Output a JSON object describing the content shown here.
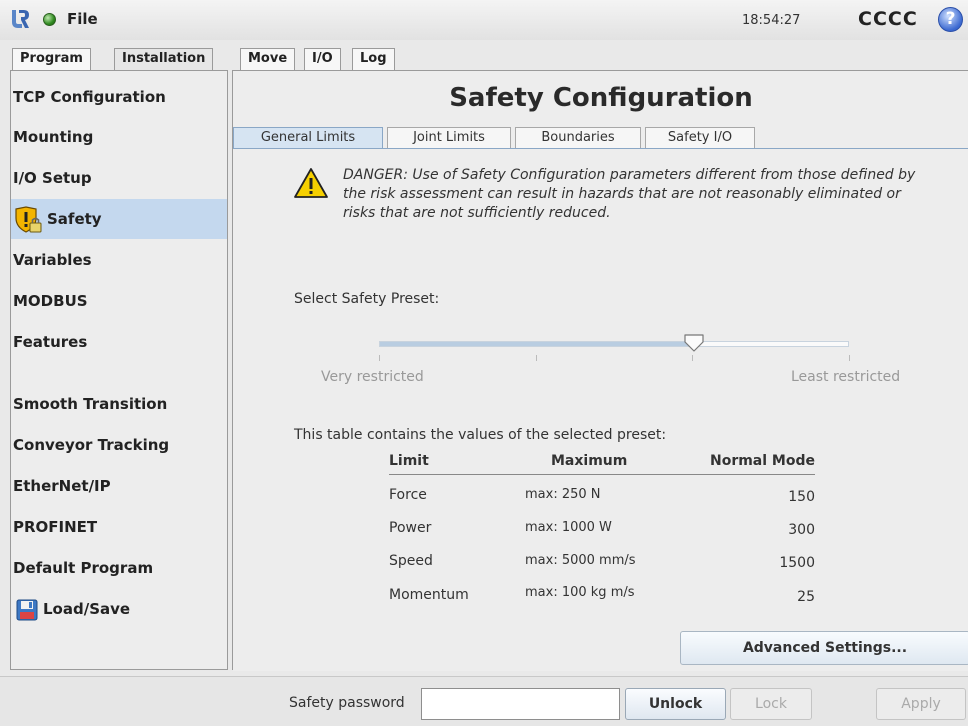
{
  "header": {
    "file_label": "File",
    "clock": "18:54:27",
    "robot_name": "CCCC",
    "help_glyph": "?"
  },
  "main_tabs": [
    {
      "label": "Program",
      "active": false
    },
    {
      "label": "Installation",
      "active": true
    },
    {
      "label": "Move",
      "active": false
    },
    {
      "label": "I/O",
      "active": false
    },
    {
      "label": "Log",
      "active": false
    }
  ],
  "sidebar": {
    "items": [
      {
        "label": "TCP Configuration"
      },
      {
        "label": "Mounting"
      },
      {
        "label": "I/O Setup"
      },
      {
        "label": "Safety",
        "icon": "shield-lock-icon",
        "active": true
      },
      {
        "label": "Variables"
      },
      {
        "label": "MODBUS"
      },
      {
        "label": "Features"
      },
      {
        "label": "Smooth Transition"
      },
      {
        "label": "Conveyor Tracking"
      },
      {
        "label": "EtherNet/IP"
      },
      {
        "label": "PROFINET"
      },
      {
        "label": "Default Program"
      },
      {
        "label": "Load/Save",
        "icon": "floppy-disk-icon"
      }
    ]
  },
  "panel": {
    "title": "Safety Configuration",
    "tabs": [
      {
        "label": "General Limits",
        "active": true
      },
      {
        "label": "Joint Limits",
        "active": false
      },
      {
        "label": "Boundaries",
        "active": false
      },
      {
        "label": "Safety I/O",
        "active": false
      }
    ],
    "danger_text": "DANGER: Use of Safety Configuration parameters different from those defined by the risk assessment can result in hazards that are not reasonably eliminated or risks that are not sufficiently reduced.",
    "preset": {
      "label": "Select Safety Preset:",
      "min_label": "Very restricted",
      "max_label": "Least restricted",
      "value_fraction": 0.67
    },
    "table_intro": "This table contains the values of the selected preset:",
    "table": {
      "headers": [
        "Limit",
        "Maximum",
        "Normal Mode"
      ],
      "rows": [
        {
          "limit": "Force",
          "maximum": "max: 250 N",
          "normal": "150"
        },
        {
          "limit": "Power",
          "maximum": "max: 1000 W",
          "normal": "300"
        },
        {
          "limit": "Speed",
          "maximum": "max: 5000 mm/s",
          "normal": "1500"
        },
        {
          "limit": "Momentum",
          "maximum": "max: 100 kg m/s",
          "normal": "25"
        }
      ]
    },
    "advanced_button": "Advanced Settings..."
  },
  "footer": {
    "password_label": "Safety password",
    "password_value": "",
    "unlock_label": "Unlock",
    "lock_label": "Lock",
    "apply_label": "Apply"
  },
  "colors": {
    "active_selection": "#c4d8ee",
    "warning_yellow": "#f6d000",
    "disabled_text": "#aaaaaa"
  }
}
